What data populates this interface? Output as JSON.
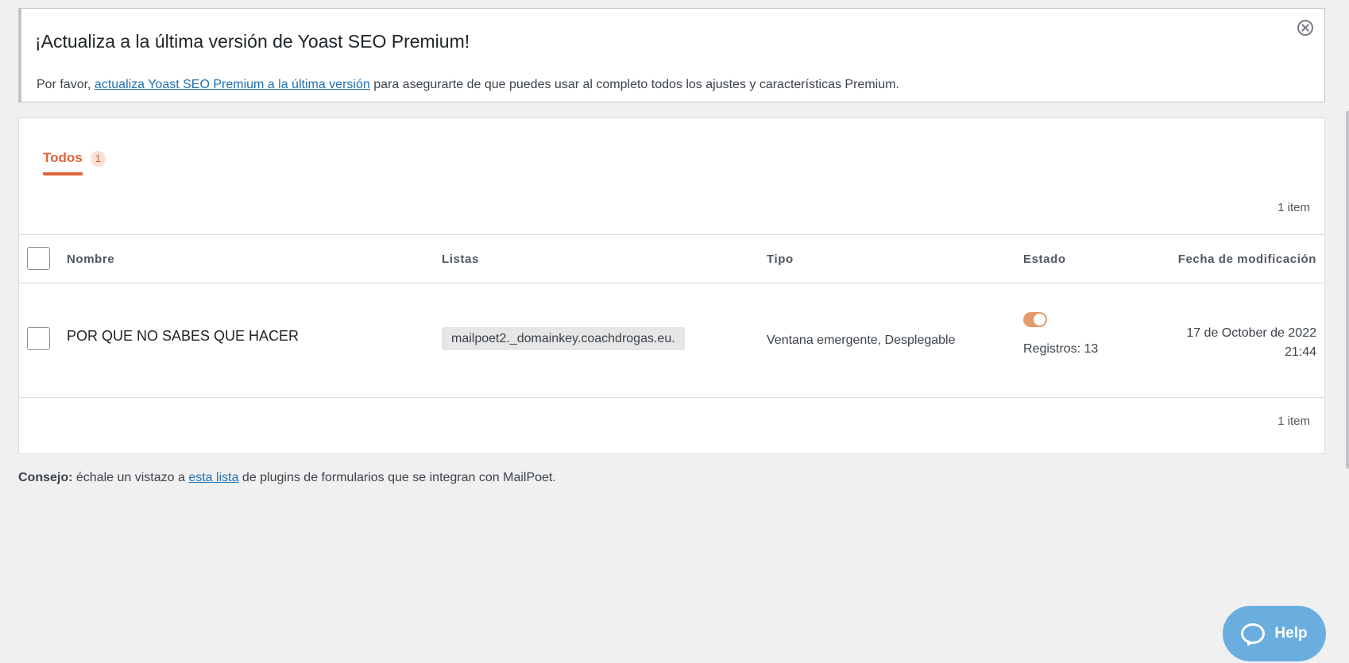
{
  "notice": {
    "title": "¡Actualiza a la última versión de Yoast SEO Premium!",
    "text_prefix": "Por favor, ",
    "link_text": "actualiza Yoast SEO Premium a la última versión",
    "text_suffix": " para asegurarte de que puedes usar al completo todos los ajustes y características Premium."
  },
  "tabs": [
    {
      "label": "Todos",
      "count": "1"
    }
  ],
  "items_count": "1 item",
  "table": {
    "headers": {
      "name": "Nombre",
      "lists": "Listas",
      "type": "Tipo",
      "status": "Estado",
      "modified": "Fecha de modificación"
    },
    "rows": [
      {
        "name": "POR QUE NO SABES QUE HACER",
        "list": "mailpoet2._domainkey.coachdrogas.eu.",
        "type": "Ventana emergente, Desplegable",
        "enabled": true,
        "registros": "Registros: 13",
        "date_line1": "17 de October de 2022",
        "date_line2": "21:44"
      }
    ]
  },
  "tip": {
    "label": "Consejo:",
    "text_prefix": " échale un vistazo a ",
    "link_text": "esta lista",
    "text_suffix": " de plugins de formularios que se integran con MailPoet."
  },
  "help": {
    "label": "Help"
  },
  "colors": {
    "accent": "#e2623a",
    "link": "#2271b1",
    "help": "#6aaee0"
  }
}
